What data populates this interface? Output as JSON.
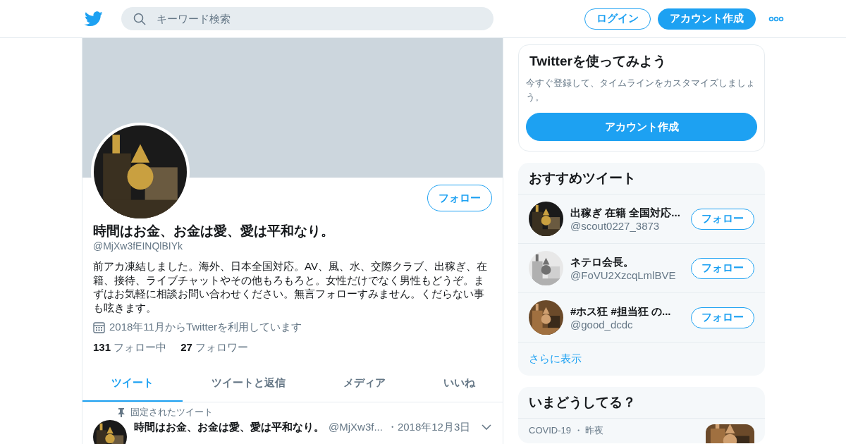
{
  "header": {
    "search": {
      "placeholder": "キーワード検索"
    },
    "buttons": [
      {
        "label": "ログイン",
        "kind": "outline"
      },
      {
        "label": "アカウント作成",
        "kind": "primary"
      }
    ]
  },
  "profile": {
    "follow_button": "フォロー",
    "name": "時間はお金、お金は愛、愛は平和なり。",
    "handle": "@MjXw3fEINQlBIYk",
    "bio": "前アカ凍結しました。海外、日本全国対応。AV、風、水、交際クラブ、出稼ぎ、在籍、接待、ライブチャットやその他もろもろと。女性だけでなく男性もどうぞ。まずはお気軽に相談お問い合わせください。無言フォローすみません。くだらない事も呟きます。",
    "joined": "2018年11月からTwitterを利用しています",
    "stats": [
      {
        "count": "131",
        "label": "フォロー中"
      },
      {
        "count": "27",
        "label": "フォロワー"
      }
    ]
  },
  "tabs": [
    {
      "label": "ツイート",
      "selected": true
    },
    {
      "label": "ツイートと返信",
      "selected": false
    },
    {
      "label": "メディア",
      "selected": false
    },
    {
      "label": "いいね",
      "selected": false
    }
  ],
  "pinned_tweet": {
    "context": "固定されたツイート",
    "name": "時間はお金、お金は愛、愛は平和なり。",
    "handle": "@MjXw3f...",
    "date": "・2018年12月3日"
  },
  "signup_card": {
    "title": "Twitterを使ってみよう",
    "text": "今すぐ登録して、タイムラインをカスタマイズしましょう。",
    "button": "アカウント作成"
  },
  "recommended": {
    "title": "おすすめツイート",
    "accounts": [
      {
        "name": "出稼ぎ 在籍 全国対応...",
        "handle": "@scout0227_3873",
        "button": "フォロー"
      },
      {
        "name": "ネテロ会長。",
        "handle": "@FoVU2XzcqLmlBVE",
        "button": "フォロー"
      },
      {
        "name": "#ホス狂 #担当狂 の...",
        "handle": "@good_dcdc",
        "button": "フォロー"
      }
    ],
    "more": "さらに表示"
  },
  "trends": {
    "title": "いまどうしてる？",
    "items": [
      {
        "context": "COVID-19",
        "time": "・ 昨夜"
      }
    ]
  }
}
